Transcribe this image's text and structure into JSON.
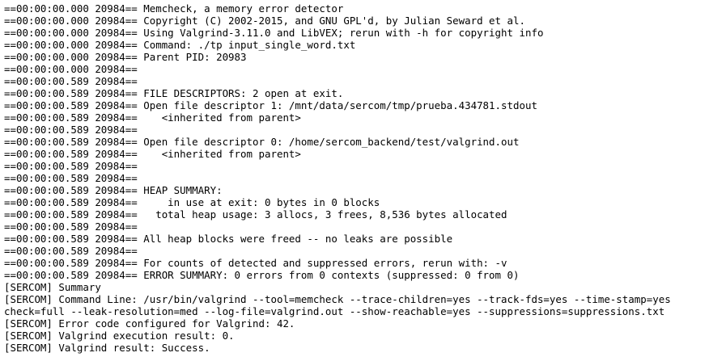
{
  "terminal": {
    "lines": [
      "==00:00:00.000 20984== Memcheck, a memory error detector",
      "==00:00:00.000 20984== Copyright (C) 2002-2015, and GNU GPL'd, by Julian Seward et al.",
      "==00:00:00.000 20984== Using Valgrind-3.11.0 and LibVEX; rerun with -h for copyright info",
      "==00:00:00.000 20984== Command: ./tp input_single_word.txt",
      "==00:00:00.000 20984== Parent PID: 20983",
      "==00:00:00.000 20984==",
      "==00:00:00.589 20984==",
      "==00:00:00.589 20984== FILE DESCRIPTORS: 2 open at exit.",
      "==00:00:00.589 20984== Open file descriptor 1: /mnt/data/sercom/tmp/prueba.434781.stdout",
      "==00:00:00.589 20984==    <inherited from parent>",
      "==00:00:00.589 20984==",
      "==00:00:00.589 20984== Open file descriptor 0: /home/sercom_backend/test/valgrind.out",
      "==00:00:00.589 20984==    <inherited from parent>",
      "==00:00:00.589 20984==",
      "==00:00:00.589 20984==",
      "==00:00:00.589 20984== HEAP SUMMARY:",
      "==00:00:00.589 20984==     in use at exit: 0 bytes in 0 blocks",
      "==00:00:00.589 20984==   total heap usage: 3 allocs, 3 frees, 8,536 bytes allocated",
      "==00:00:00.589 20984==",
      "==00:00:00.589 20984== All heap blocks were freed -- no leaks are possible",
      "==00:00:00.589 20984==",
      "==00:00:00.589 20984== For counts of detected and suppressed errors, rerun with: -v",
      "==00:00:00.589 20984== ERROR SUMMARY: 0 errors from 0 contexts (suppressed: 0 from 0)",
      "[SERCOM] Summary",
      "[SERCOM] Command Line: /usr/bin/valgrind --tool=memcheck --trace-children=yes --track-fds=yes --time-stamp=yes",
      "check=full --leak-resolution=med --log-file=valgrind.out --show-reachable=yes --suppressions=suppressions.txt",
      "[SERCOM] Error code configured for Valgrind: 42.",
      "[SERCOM] Valgrind execution result: 0.",
      "[SERCOM] Valgrind result: Success."
    ]
  }
}
